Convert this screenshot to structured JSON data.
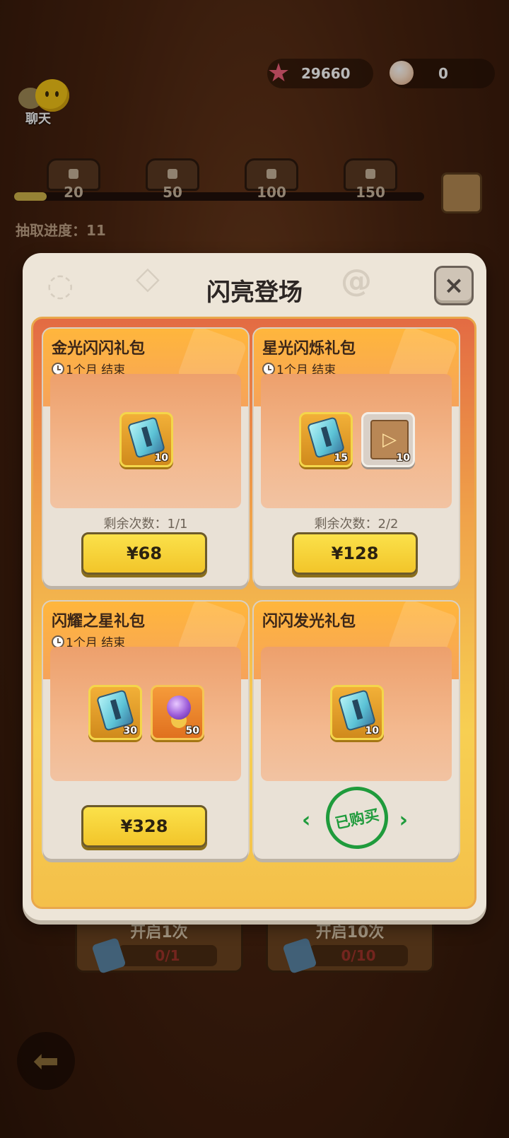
{
  "hud": {
    "starfish_amount": "29660",
    "pearl_amount": "0",
    "chat_label": "聊天"
  },
  "progress": {
    "milestones": [
      "20",
      "50",
      "100",
      "150"
    ],
    "draw_progress_text": "抽取进度：11",
    "fill_fraction": 0.08
  },
  "open_buttons": [
    {
      "label": "开启1次",
      "count": "0/1"
    },
    {
      "label": "开启10次",
      "count": "0/10"
    }
  ],
  "modal": {
    "title": "闪亮登场",
    "close_glyph": "×",
    "packs": [
      {
        "name": "金光闪闪礼包",
        "timer": "1个月 结束",
        "items": [
          {
            "icon": "ticket-icon",
            "qty": "10"
          }
        ],
        "remaining": "剩余次数：1/1",
        "price": "¥68"
      },
      {
        "name": "星光闪烁礼包",
        "timer": "1个月 结束",
        "items": [
          {
            "icon": "ticket-icon",
            "qty": "15"
          },
          {
            "icon": "video-scroll-icon",
            "qty": "10"
          }
        ],
        "remaining": "剩余次数：2/2",
        "price": "¥128"
      },
      {
        "name": "闪耀之星礼包",
        "timer": "1个月 结束",
        "items": [
          {
            "icon": "ticket-icon",
            "qty": "30"
          },
          {
            "icon": "orb-icon",
            "qty": "50"
          }
        ],
        "price": "¥328"
      },
      {
        "name": "闪闪发光礼包",
        "items": [
          {
            "icon": "ticket-icon",
            "qty": "10"
          }
        ],
        "purchased_stamp": "已购买"
      }
    ]
  },
  "colors": {
    "buy_button": "#f6d236",
    "stamp_green": "#1f9b3c",
    "card_header": "#ffb63c"
  }
}
